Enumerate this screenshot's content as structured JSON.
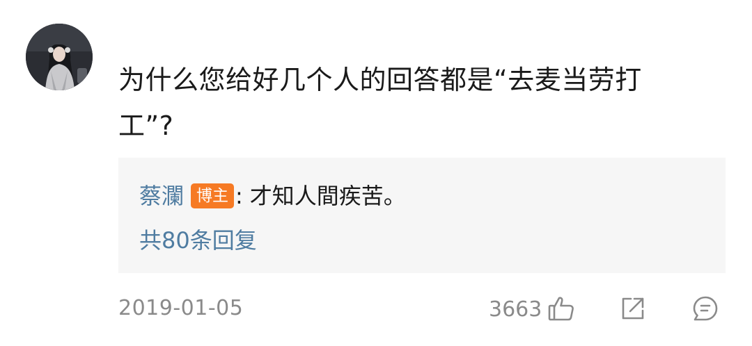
{
  "comment": {
    "avatar_icon": "user-avatar",
    "text": "为什么您给好几个人的回答都是“去麦当劳打工”?",
    "reply": {
      "author": "蔡瀾",
      "author_badge": "博主",
      "colon": ":",
      "text": "才知人間疾苦。",
      "count_label": "共80条回复"
    },
    "date": "2019-01-05",
    "likes": "3663",
    "actions": {
      "like_icon": "thumbs-up-icon",
      "share_icon": "share-icon",
      "reply_icon": "comment-icon"
    },
    "colors": {
      "link_blue": "#4f7ca1",
      "badge_orange": "#f67a24",
      "reply_background": "#f6f6f6",
      "meta_gray": "#8a8a8a"
    }
  }
}
